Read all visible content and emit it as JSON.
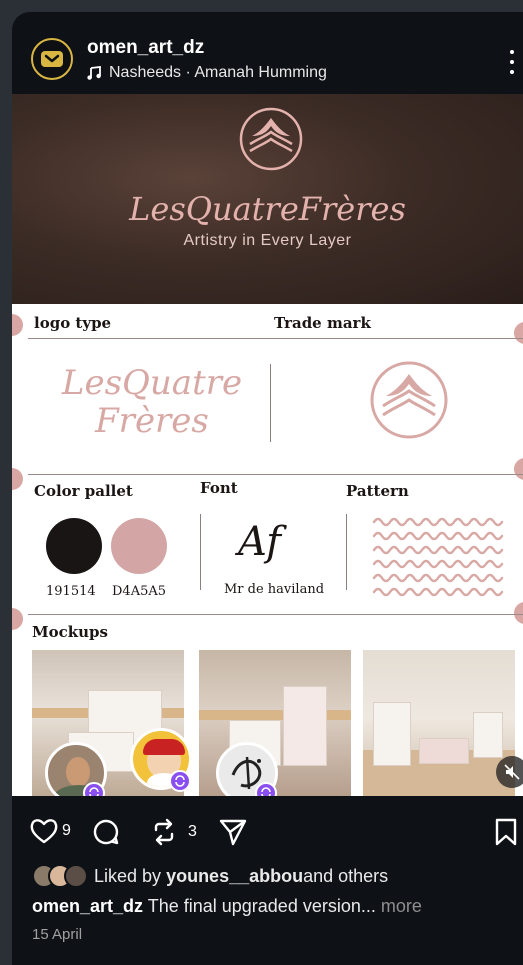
{
  "post": {
    "username": "omen_art_dz",
    "music": "Nasheeds · Amanah Humming",
    "hero": {
      "wordmark": "LesQuatreFrères",
      "tagline": "Artistry in Every Layer"
    },
    "sections": {
      "logo_type": "logo type",
      "trade_mark": "Trade mark",
      "color_pallet": "Color pallet",
      "font": "Font",
      "pattern": "Pattern",
      "mockups": "Mockups"
    },
    "script_logo": {
      "line1": "LesQuatre",
      "line2": "Frères"
    },
    "colors": [
      {
        "label": "191514",
        "hex": "#191514"
      },
      {
        "label": "D4A5A5",
        "hex": "#D4A5A5"
      }
    ],
    "font_sample": "Af",
    "font_name": "Mr de haviland"
  },
  "actions": {
    "likes": "9",
    "reposts": "3"
  },
  "liked_by": {
    "prefix": "Liked by ",
    "user": "younes__abbou",
    "suffix": " and others"
  },
  "caption": {
    "user": "omen_art_dz",
    "text": " The final upgraded version...",
    "more": " more"
  },
  "date": "15 April",
  "icons": [
    "logo-avatar-icon",
    "music-note-icon",
    "more-vertical-icon",
    "heart-icon",
    "comment-icon",
    "repost-icon",
    "share-icon",
    "bookmark-icon",
    "mute-icon"
  ],
  "colors": {
    "background": "#0e1217",
    "accent_pink": "#D4A5A5",
    "avatar_ring": "#d9b642",
    "tag_badge": "#8a4ff0"
  }
}
